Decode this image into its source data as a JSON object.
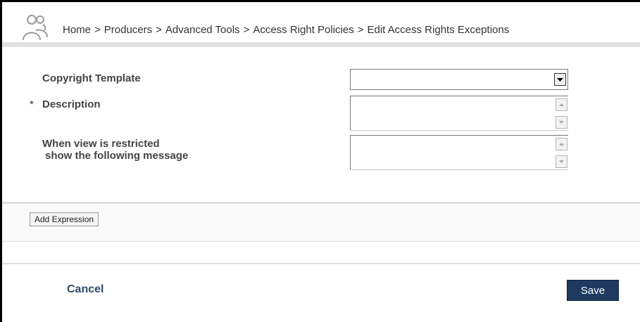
{
  "header": {
    "icon": "people-icon",
    "breadcrumb": [
      "Home",
      "Producers",
      "Advanced Tools",
      "Access Right Policies",
      "Edit Access Rights Exceptions"
    ],
    "separator": ">"
  },
  "form": {
    "copyright_label": "Copyright Template",
    "copyright_value": "",
    "required_marker": "*",
    "description_label": "Description",
    "description_value": "",
    "restricted_label_line1": "When view is restricted",
    "restricted_label_line2": "show the following message",
    "restricted_value": ""
  },
  "expressions": {
    "add_label": "Add Expression"
  },
  "footer": {
    "cancel_label": "Cancel",
    "save_label": "Save"
  },
  "colors": {
    "save_bg": "#1f3a5f",
    "cancel_text": "#2f4a6a"
  }
}
